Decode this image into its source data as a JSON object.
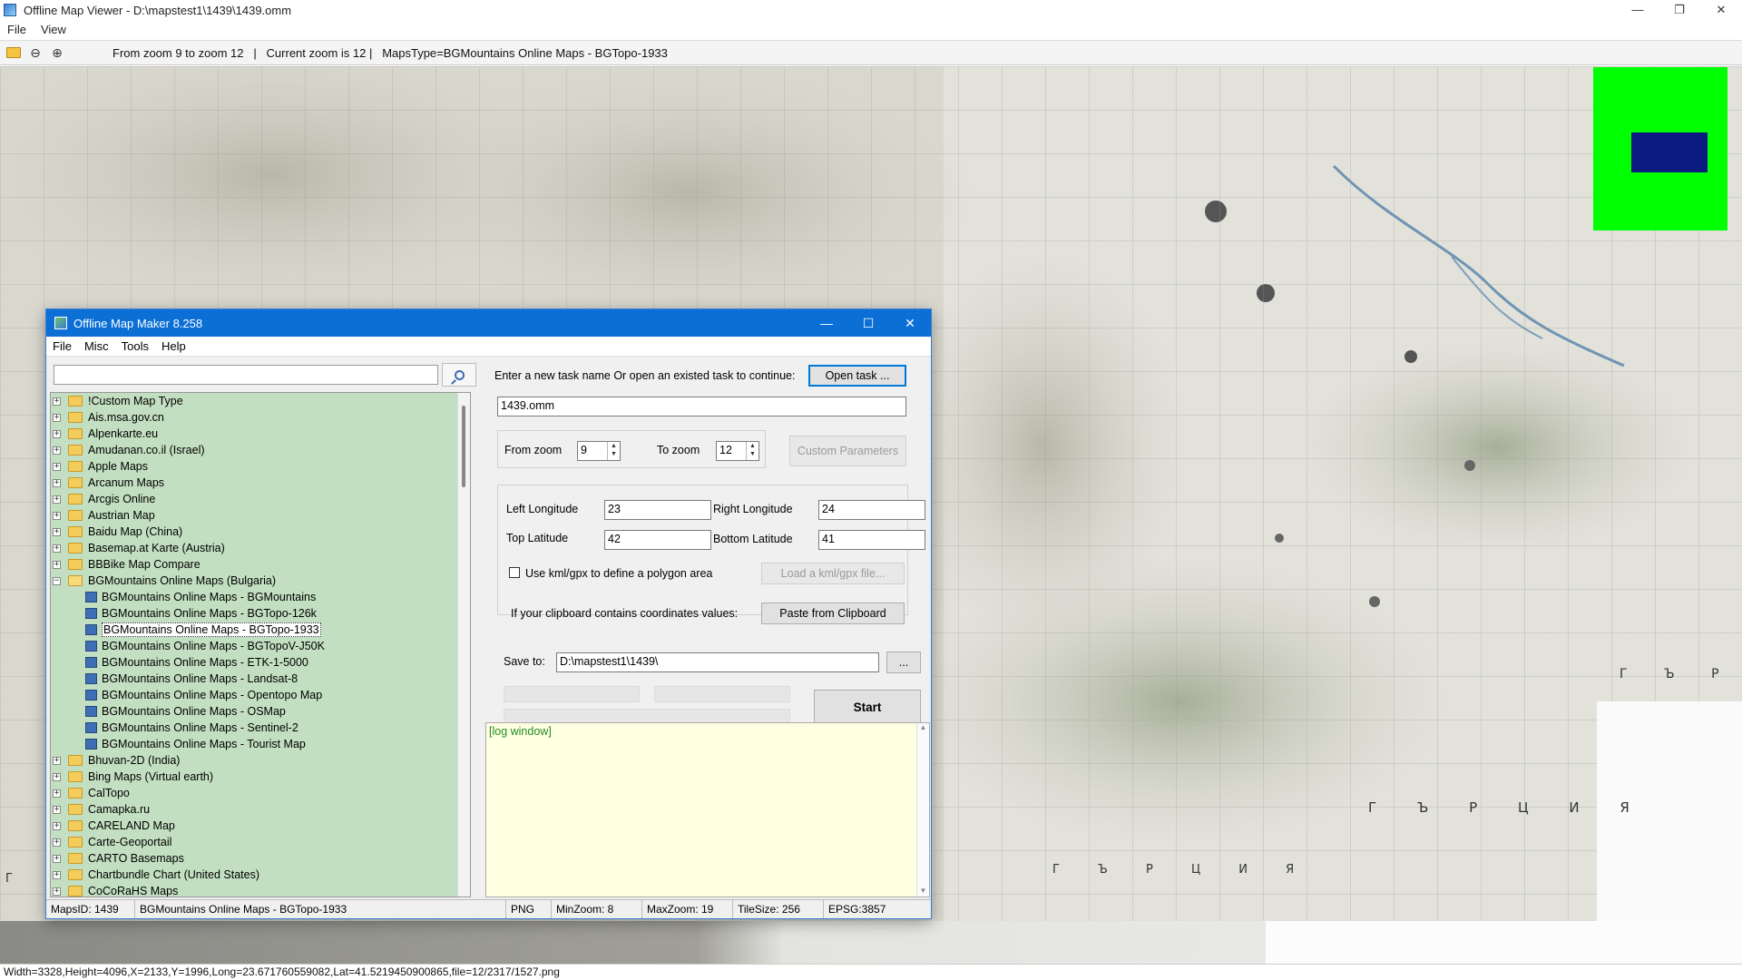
{
  "viewer": {
    "title": "Offline Map Viewer - D:\\mapstest1\\1439\\1439.omm",
    "controls": {
      "minimize": "—",
      "maximize": "❐",
      "close": "✕"
    },
    "menu": [
      "File",
      "View"
    ],
    "toolbar_status": "From zoom 9 to zoom 12   |   Current zoom is 12 |   MapsType=BGMountains Online Maps - BGTopo-1933",
    "status_bar": "Width=3328,Height=4096,X=2133,Y=1996,Long=23.671760559082,Lat=41.5219450900865,file=12/2317/1527.png",
    "map_labels": {
      "label_1": "Г Ъ Р Ц",
      "label_2": "Г Ъ Р Ц И Я",
      "label_3": "Г Ъ Р Ц И Я",
      "label_4": "Г Ъ"
    }
  },
  "maker": {
    "title": "Offline Map Maker 8.258",
    "controls": {
      "minimize": "—",
      "maximize": "☐",
      "close": "✕"
    },
    "menu": [
      "File",
      "Misc",
      "Tools",
      "Help"
    ],
    "search": {
      "value": "",
      "placeholder": ""
    },
    "tree": [
      {
        "label": "!Custom Map Type",
        "expanded": false
      },
      {
        "label": "Ais.msa.gov.cn",
        "expanded": false
      },
      {
        "label": "Alpenkarte.eu",
        "expanded": false
      },
      {
        "label": "Amudanan.co.il (Israel)",
        "expanded": false
      },
      {
        "label": "Apple Maps",
        "expanded": false
      },
      {
        "label": "Arcanum Maps",
        "expanded": false
      },
      {
        "label": "Arcgis Online",
        "expanded": false
      },
      {
        "label": "Austrian Map",
        "expanded": false
      },
      {
        "label": "Baidu Map (China)",
        "expanded": false
      },
      {
        "label": "Basemap.at Karte (Austria)",
        "expanded": false
      },
      {
        "label": "BBBike Map Compare",
        "expanded": false
      },
      {
        "label": "BGMountains Online Maps (Bulgaria)",
        "expanded": true,
        "children": [
          "BGMountains Online Maps - BGMountains",
          "BGMountains Online Maps - BGTopo-126k",
          "BGMountains Online Maps - BGTopo-1933",
          "BGMountains Online Maps - BGTopoV-J50K",
          "BGMountains Online Maps - ETK-1-5000",
          "BGMountains Online Maps - Landsat-8",
          "BGMountains Online Maps - Opentopo Map",
          "BGMountains Online Maps - OSMap",
          "BGMountains Online Maps - Sentinel-2",
          "BGMountains Online Maps - Tourist Map"
        ]
      },
      {
        "label": "Bhuvan-2D (India)",
        "expanded": false
      },
      {
        "label": "Bing Maps (Virtual earth)",
        "expanded": false
      },
      {
        "label": "CalTopo",
        "expanded": false
      },
      {
        "label": "Camapka.ru",
        "expanded": false
      },
      {
        "label": "CARELAND Map",
        "expanded": false
      },
      {
        "label": "Carte-Geoportail",
        "expanded": false
      },
      {
        "label": "CARTO Basemaps",
        "expanded": false
      },
      {
        "label": "Chartbundle Chart (United States)",
        "expanded": false
      },
      {
        "label": "CoCoRaHS Maps",
        "expanded": false
      }
    ],
    "selected_child": "BGMountains Online Maps - BGTopo-1933",
    "task_prompt": "Enter a new task name Or open an existed task to continue:",
    "open_task_label": "Open task ...",
    "task_name": "1439.omm",
    "from_zoom_label": "From zoom",
    "from_zoom": "9",
    "to_zoom_label": "To zoom",
    "to_zoom": "12",
    "custom_params_label": "Custom Parameters",
    "left_longitude_label": "Left Longitude",
    "left_longitude": "23",
    "right_longitude_label": "Right Longitude",
    "right_longitude": "24",
    "top_latitude_label": "Top Latitude",
    "top_latitude": "42",
    "bottom_latitude_label": "Bottom Latitude",
    "bottom_latitude": "41",
    "kml_checkbox_label": "Use kml/gpx to define a polygon area",
    "kml_checked": false,
    "load_kml_label": "Load a kml/gpx file...",
    "clipboard_prompt": "If your clipboard contains coordinates values:",
    "paste_label": "Paste from Clipboard",
    "save_to_label": "Save to:",
    "save_to": "D:\\mapstest1\\1439\\",
    "browse_label": "...",
    "start_label": "Start",
    "log_text": "[log window]",
    "status": {
      "maps_id": "MapsID: 1439",
      "map_name": "BGMountains Online Maps - BGTopo-1933",
      "format": "PNG",
      "min_zoom": "MinZoom: 8",
      "max_zoom": "MaxZoom: 19",
      "tile_size": "TileSize: 256",
      "epsg": "EPSG:3857"
    }
  },
  "colors": {
    "maker_title_bg": "#0b6fd6",
    "tree_bg": "#c3dfc1",
    "log_bg": "#ffffe1",
    "overview_bg": "#00ff00",
    "overview_viewport": "#0b1a80"
  }
}
